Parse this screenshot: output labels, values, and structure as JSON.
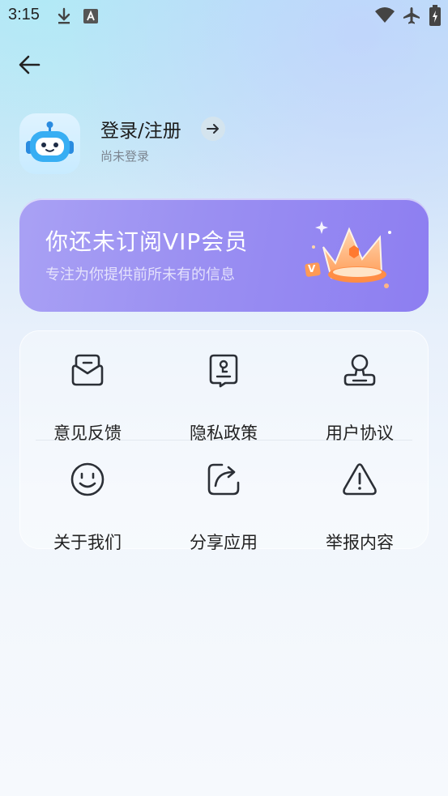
{
  "status_bar": {
    "time": "3:15",
    "left_icons": [
      "download-icon",
      "text-a-icon"
    ],
    "right_icons": [
      "wifi-icon",
      "airplane-icon",
      "battery-charging-icon"
    ]
  },
  "header": {
    "back_icon": "back-arrow-icon"
  },
  "profile": {
    "login_label": "登录/注册",
    "status_text": "尚未登录"
  },
  "vip": {
    "title": "你还未订阅VIP会员",
    "subtitle": "专注为你提供前所未有的信息",
    "badge_letter": "V"
  },
  "menu": {
    "items": [
      {
        "label": "意见反馈",
        "icon": "feedback-mail-icon"
      },
      {
        "label": "隐私政策",
        "icon": "privacy-doc-icon"
      },
      {
        "label": "用户协议",
        "icon": "user-agreement-icon"
      },
      {
        "label": "关于我们",
        "icon": "smile-icon"
      },
      {
        "label": "分享应用",
        "icon": "share-icon"
      },
      {
        "label": "举报内容",
        "icon": "warning-icon"
      }
    ]
  },
  "colors": {
    "vip_gradient_start": "#a9a1f4",
    "vip_gradient_end": "#8d7ef1",
    "icon_stroke": "#2b2f36"
  }
}
